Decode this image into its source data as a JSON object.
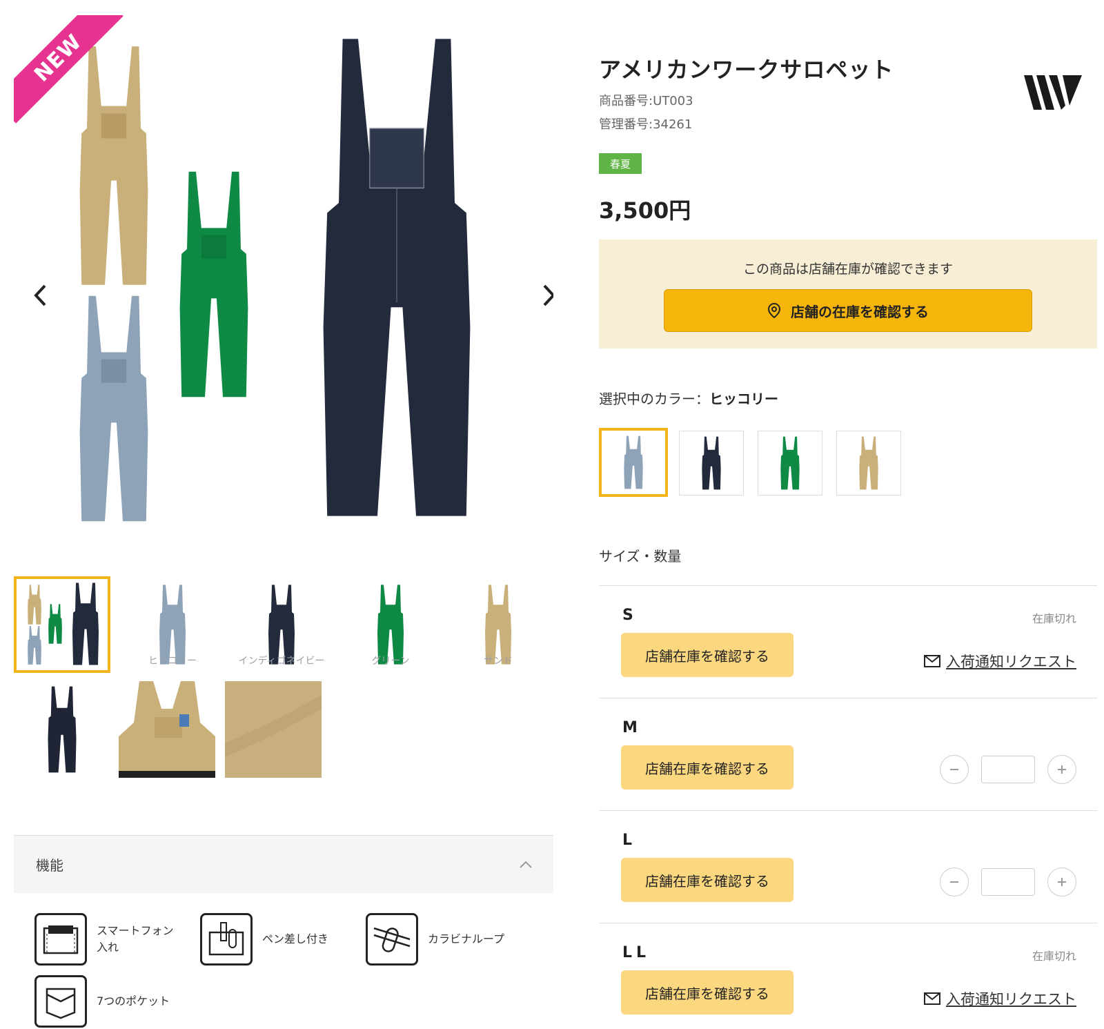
{
  "product": {
    "title": "アメリカンワークサロペット",
    "product_number": "商品番号:UT003",
    "management_number": "管理番号:34261",
    "season": "春夏",
    "price": "3,500円",
    "new_badge": "NEW"
  },
  "stock": {
    "message": "この商品は店舗在庫が確認できます",
    "cta_label": "店舗の在庫を確認する"
  },
  "color": {
    "label": "選択中のカラー：",
    "selected": "ヒッコリー"
  },
  "gallery": {
    "captions": [
      "ヒッコリー",
      "インディゴネイビー",
      "グリーン",
      "サンド"
    ]
  },
  "colors": {
    "sand": "#c9b07a",
    "green": "#0f8a45",
    "hickory": "#8fa3b8",
    "navy": "#232a3b",
    "accent": "#f3b51b",
    "season_green": "#5fb446",
    "new_pink": "#e6338f"
  },
  "features": {
    "title": "機能",
    "items": [
      {
        "label": "スマートフォン入れ",
        "icon": "smartphone-pocket-icon"
      },
      {
        "label": "ペン差し付き",
        "icon": "pen-holder-icon"
      },
      {
        "label": "カラビナループ",
        "icon": "carabiner-loop-icon"
      },
      {
        "label": "7つのポケット",
        "icon": "pocket-icon"
      }
    ]
  },
  "sizes": {
    "heading": "サイズ・数量",
    "store_button": "店舗在庫を確認する",
    "soldout_label": "在庫切れ",
    "notify_label": "入荷通知リクエスト",
    "rows": [
      {
        "name": "S",
        "soldout": true
      },
      {
        "name": "M",
        "soldout": false
      },
      {
        "name": "L",
        "soldout": false
      },
      {
        "name": "LL",
        "soldout": true
      }
    ]
  }
}
